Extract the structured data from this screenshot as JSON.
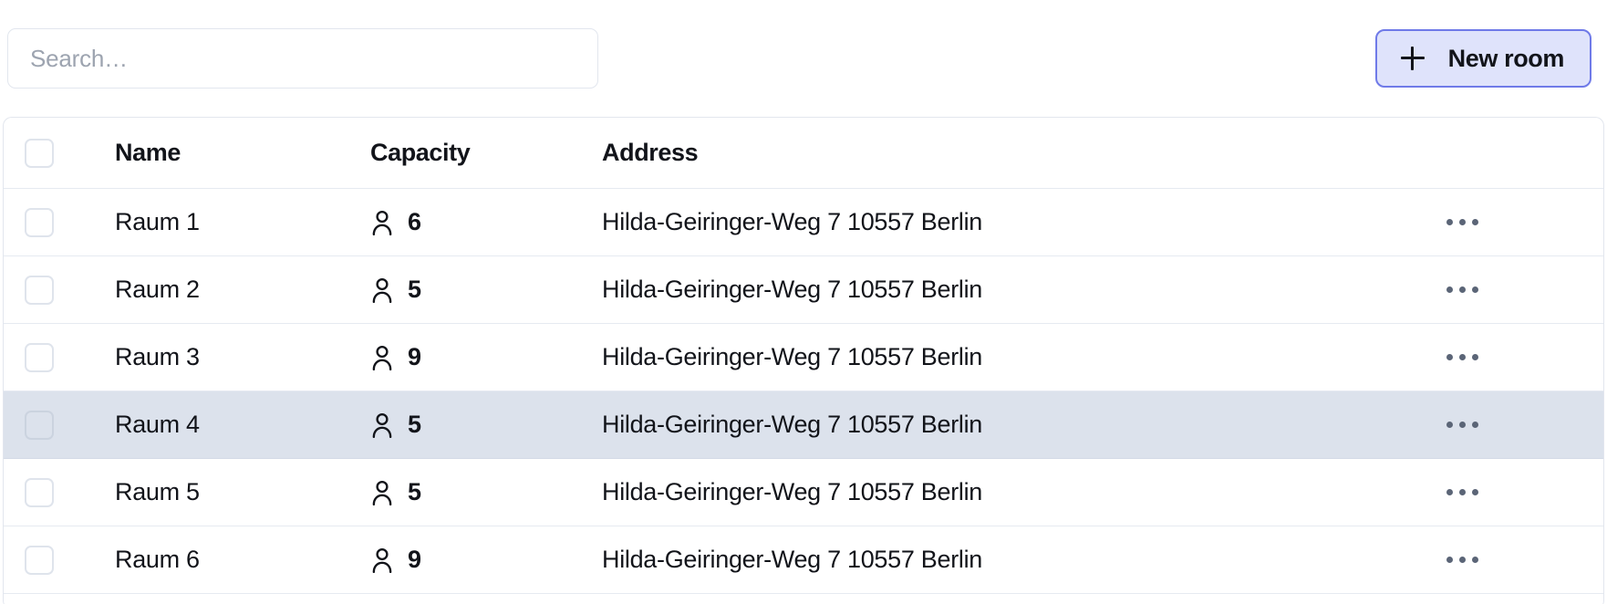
{
  "toolbar": {
    "search": {
      "placeholder": "Search…",
      "value": ""
    },
    "new_room_button": {
      "label": "New room",
      "icon": "plus-icon",
      "background": "#dfe3fb",
      "border": "#6f7ae8",
      "text_color": "#12141a"
    }
  },
  "table": {
    "columns": {
      "select": "",
      "name": "Name",
      "capacity": "Capacity",
      "address": "Address",
      "actions": ""
    },
    "capacity_icon": "person-icon",
    "row_actions_icon": "more-horizontal-icon",
    "selected_row_color": "#dce2ec",
    "rows": [
      {
        "name": "Raum 1",
        "capacity": "6",
        "address": "Hilda-Geiringer-Weg 7 10557 Berlin",
        "selected": false,
        "checked": false
      },
      {
        "name": "Raum 2",
        "capacity": "5",
        "address": "Hilda-Geiringer-Weg 7 10557 Berlin",
        "selected": false,
        "checked": false
      },
      {
        "name": "Raum 3",
        "capacity": "9",
        "address": "Hilda-Geiringer-Weg 7 10557 Berlin",
        "selected": false,
        "checked": false
      },
      {
        "name": "Raum 4",
        "capacity": "5",
        "address": "Hilda-Geiringer-Weg 7 10557 Berlin",
        "selected": true,
        "checked": false
      },
      {
        "name": "Raum 5",
        "capacity": "5",
        "address": "Hilda-Geiringer-Weg 7 10557 Berlin",
        "selected": false,
        "checked": false
      },
      {
        "name": "Raum 6",
        "capacity": "9",
        "address": "Hilda-Geiringer-Weg 7 10557 Berlin",
        "selected": false,
        "checked": false
      }
    ]
  }
}
